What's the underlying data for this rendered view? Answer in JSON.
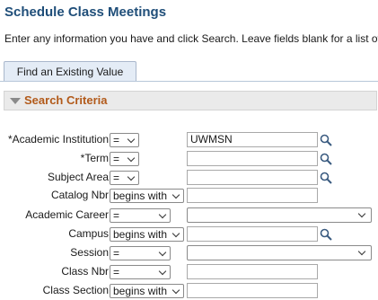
{
  "page": {
    "title": "Schedule Class Meetings",
    "instructions": "Enter any information you have and click Search. Leave fields blank for a list of"
  },
  "tabs": [
    {
      "label": "Find an Existing Value",
      "active": true
    }
  ],
  "search_criteria": {
    "header": "Search Criteria",
    "fields": [
      {
        "label": "*Academic Institution",
        "operator": "=",
        "value": "UWMSN",
        "lookup": true
      },
      {
        "label": "*Term",
        "operator": "=",
        "value": "",
        "lookup": true
      },
      {
        "label": "Subject Area",
        "operator": "=",
        "value": "",
        "lookup": true
      },
      {
        "label": "Catalog Nbr",
        "operator": "begins with",
        "value": "",
        "lookup": false
      },
      {
        "label": "Academic Career",
        "operator": "=",
        "value": "",
        "lookup": false,
        "dropdown": true
      },
      {
        "label": "Campus",
        "operator": "begins with",
        "value": "",
        "lookup": true
      },
      {
        "label": "Session",
        "operator": "=",
        "value": "",
        "lookup": false,
        "dropdown": true
      },
      {
        "label": "Class Nbr",
        "operator": "=",
        "value": "",
        "lookup": false
      },
      {
        "label": "Class Section",
        "operator": "begins with",
        "value": "",
        "lookup": false
      }
    ]
  },
  "colors": {
    "title": "#1f4e79",
    "section_header_text": "#b25a1a",
    "tab_background": "#e4ecf6"
  },
  "icons": {
    "lookup": "magnifier-icon",
    "section_toggle": "triangle-down-icon",
    "dropdown": "chevron-down-icon"
  }
}
